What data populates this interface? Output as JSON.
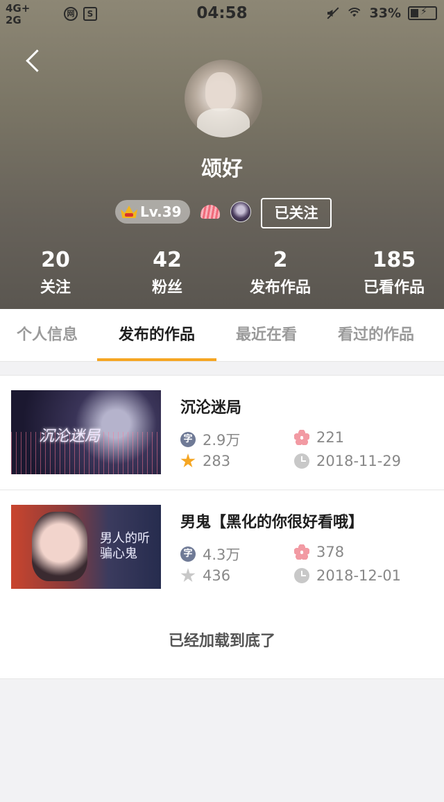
{
  "status_bar": {
    "network_top": "4G+",
    "network_bottom": "2G",
    "app_icon_1": "网",
    "app_icon_2": "S",
    "time": "04:58",
    "battery": "33%"
  },
  "profile": {
    "name": "颂好",
    "level": "Lv.39",
    "follow_button": "已关注"
  },
  "stats": [
    {
      "value": "20",
      "label": "关注"
    },
    {
      "value": "42",
      "label": "粉丝"
    },
    {
      "value": "2",
      "label": "发布作品"
    },
    {
      "value": "185",
      "label": "已看作品"
    }
  ],
  "tabs": [
    {
      "label": "个人信息",
      "active": false
    },
    {
      "label": "发布的作品",
      "active": true
    },
    {
      "label": "最近在看",
      "active": false
    },
    {
      "label": "看过的作品",
      "active": false
    }
  ],
  "works": [
    {
      "title": "沉沦迷局",
      "word_icon": "字",
      "words": "2.9万",
      "flowers": "221",
      "stars": "283",
      "date": "2018-11-29"
    },
    {
      "title": "男鬼【黑化的你很好看哦】",
      "word_icon": "字",
      "words": "4.3万",
      "flowers": "378",
      "stars": "436",
      "date": "2018-12-01"
    }
  ],
  "footer": "已经加载到底了",
  "colors": {
    "accent": "#f5a623",
    "header_bg": "#7a7565",
    "text_dark": "#1e1e1e",
    "text_muted": "#888888"
  }
}
